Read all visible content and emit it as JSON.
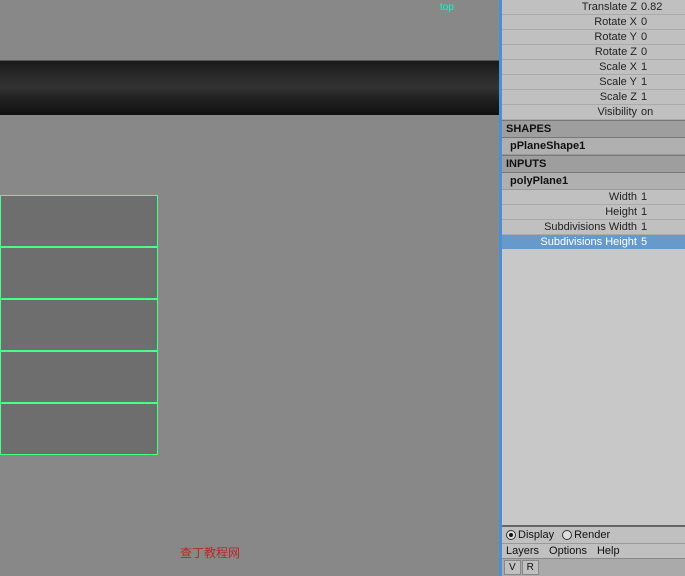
{
  "viewport": {
    "top_label": "top",
    "background_color": "#888888"
  },
  "attribute_editor": {
    "transform_section": {
      "rows": [
        {
          "label": "Translate Z",
          "value": "0.82"
        },
        {
          "label": "Rotate X",
          "value": "0"
        },
        {
          "label": "Rotate Y",
          "value": "0"
        },
        {
          "label": "Rotate Z",
          "value": "0"
        },
        {
          "label": "Scale X",
          "value": "1"
        },
        {
          "label": "Scale Y",
          "value": "1"
        },
        {
          "label": "Scale Z",
          "value": "1"
        },
        {
          "label": "Visibility",
          "value": "on"
        }
      ]
    },
    "shapes_section": {
      "header": "SHAPES",
      "item": "pPlaneShape1"
    },
    "inputs_section": {
      "header": "INPUTS",
      "item": "polyPlane1",
      "rows": [
        {
          "label": "Width",
          "value": "1"
        },
        {
          "label": "Height",
          "value": "1"
        },
        {
          "label": "Subdivisions Width",
          "value": "1"
        },
        {
          "label": "Subdivisions Height",
          "value": "5",
          "highlighted": true
        }
      ]
    }
  },
  "bottom_panel": {
    "display_label": "Display",
    "render_label": "Render",
    "menu_items": [
      "Layers",
      "Options",
      "Help"
    ],
    "tabs": [
      "V",
      "R"
    ]
  },
  "watermark": "查丁教程网"
}
